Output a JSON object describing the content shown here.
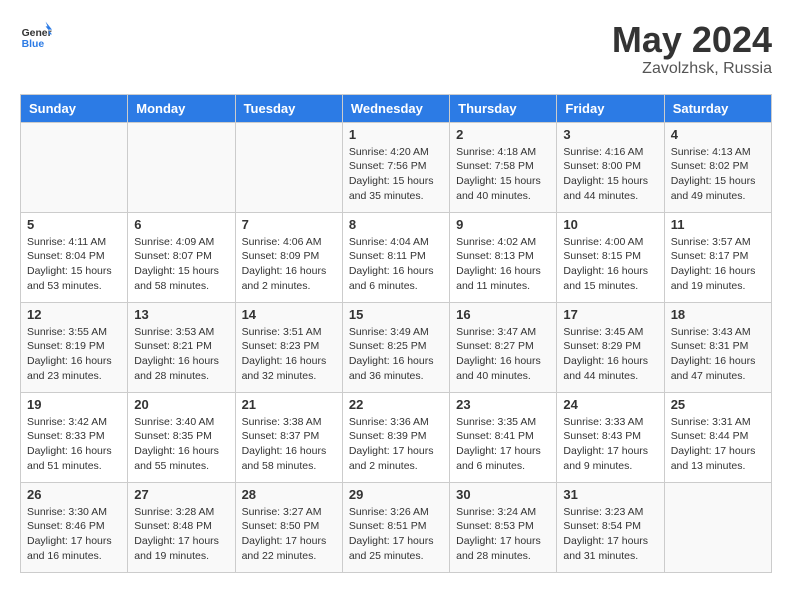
{
  "header": {
    "logo_line1": "General",
    "logo_line2": "Blue",
    "month": "May 2024",
    "location": "Zavolzhsk, Russia"
  },
  "weekdays": [
    "Sunday",
    "Monday",
    "Tuesday",
    "Wednesday",
    "Thursday",
    "Friday",
    "Saturday"
  ],
  "weeks": [
    [
      {
        "day": "",
        "info": ""
      },
      {
        "day": "",
        "info": ""
      },
      {
        "day": "",
        "info": ""
      },
      {
        "day": "1",
        "info": "Sunrise: 4:20 AM\nSunset: 7:56 PM\nDaylight: 15 hours\nand 35 minutes."
      },
      {
        "day": "2",
        "info": "Sunrise: 4:18 AM\nSunset: 7:58 PM\nDaylight: 15 hours\nand 40 minutes."
      },
      {
        "day": "3",
        "info": "Sunrise: 4:16 AM\nSunset: 8:00 PM\nDaylight: 15 hours\nand 44 minutes."
      },
      {
        "day": "4",
        "info": "Sunrise: 4:13 AM\nSunset: 8:02 PM\nDaylight: 15 hours\nand 49 minutes."
      }
    ],
    [
      {
        "day": "5",
        "info": "Sunrise: 4:11 AM\nSunset: 8:04 PM\nDaylight: 15 hours\nand 53 minutes."
      },
      {
        "day": "6",
        "info": "Sunrise: 4:09 AM\nSunset: 8:07 PM\nDaylight: 15 hours\nand 58 minutes."
      },
      {
        "day": "7",
        "info": "Sunrise: 4:06 AM\nSunset: 8:09 PM\nDaylight: 16 hours\nand 2 minutes."
      },
      {
        "day": "8",
        "info": "Sunrise: 4:04 AM\nSunset: 8:11 PM\nDaylight: 16 hours\nand 6 minutes."
      },
      {
        "day": "9",
        "info": "Sunrise: 4:02 AM\nSunset: 8:13 PM\nDaylight: 16 hours\nand 11 minutes."
      },
      {
        "day": "10",
        "info": "Sunrise: 4:00 AM\nSunset: 8:15 PM\nDaylight: 16 hours\nand 15 minutes."
      },
      {
        "day": "11",
        "info": "Sunrise: 3:57 AM\nSunset: 8:17 PM\nDaylight: 16 hours\nand 19 minutes."
      }
    ],
    [
      {
        "day": "12",
        "info": "Sunrise: 3:55 AM\nSunset: 8:19 PM\nDaylight: 16 hours\nand 23 minutes."
      },
      {
        "day": "13",
        "info": "Sunrise: 3:53 AM\nSunset: 8:21 PM\nDaylight: 16 hours\nand 28 minutes."
      },
      {
        "day": "14",
        "info": "Sunrise: 3:51 AM\nSunset: 8:23 PM\nDaylight: 16 hours\nand 32 minutes."
      },
      {
        "day": "15",
        "info": "Sunrise: 3:49 AM\nSunset: 8:25 PM\nDaylight: 16 hours\nand 36 minutes."
      },
      {
        "day": "16",
        "info": "Sunrise: 3:47 AM\nSunset: 8:27 PM\nDaylight: 16 hours\nand 40 minutes."
      },
      {
        "day": "17",
        "info": "Sunrise: 3:45 AM\nSunset: 8:29 PM\nDaylight: 16 hours\nand 44 minutes."
      },
      {
        "day": "18",
        "info": "Sunrise: 3:43 AM\nSunset: 8:31 PM\nDaylight: 16 hours\nand 47 minutes."
      }
    ],
    [
      {
        "day": "19",
        "info": "Sunrise: 3:42 AM\nSunset: 8:33 PM\nDaylight: 16 hours\nand 51 minutes."
      },
      {
        "day": "20",
        "info": "Sunrise: 3:40 AM\nSunset: 8:35 PM\nDaylight: 16 hours\nand 55 minutes."
      },
      {
        "day": "21",
        "info": "Sunrise: 3:38 AM\nSunset: 8:37 PM\nDaylight: 16 hours\nand 58 minutes."
      },
      {
        "day": "22",
        "info": "Sunrise: 3:36 AM\nSunset: 8:39 PM\nDaylight: 17 hours\nand 2 minutes."
      },
      {
        "day": "23",
        "info": "Sunrise: 3:35 AM\nSunset: 8:41 PM\nDaylight: 17 hours\nand 6 minutes."
      },
      {
        "day": "24",
        "info": "Sunrise: 3:33 AM\nSunset: 8:43 PM\nDaylight: 17 hours\nand 9 minutes."
      },
      {
        "day": "25",
        "info": "Sunrise: 3:31 AM\nSunset: 8:44 PM\nDaylight: 17 hours\nand 13 minutes."
      }
    ],
    [
      {
        "day": "26",
        "info": "Sunrise: 3:30 AM\nSunset: 8:46 PM\nDaylight: 17 hours\nand 16 minutes."
      },
      {
        "day": "27",
        "info": "Sunrise: 3:28 AM\nSunset: 8:48 PM\nDaylight: 17 hours\nand 19 minutes."
      },
      {
        "day": "28",
        "info": "Sunrise: 3:27 AM\nSunset: 8:50 PM\nDaylight: 17 hours\nand 22 minutes."
      },
      {
        "day": "29",
        "info": "Sunrise: 3:26 AM\nSunset: 8:51 PM\nDaylight: 17 hours\nand 25 minutes."
      },
      {
        "day": "30",
        "info": "Sunrise: 3:24 AM\nSunset: 8:53 PM\nDaylight: 17 hours\nand 28 minutes."
      },
      {
        "day": "31",
        "info": "Sunrise: 3:23 AM\nSunset: 8:54 PM\nDaylight: 17 hours\nand 31 minutes."
      },
      {
        "day": "",
        "info": ""
      }
    ]
  ]
}
